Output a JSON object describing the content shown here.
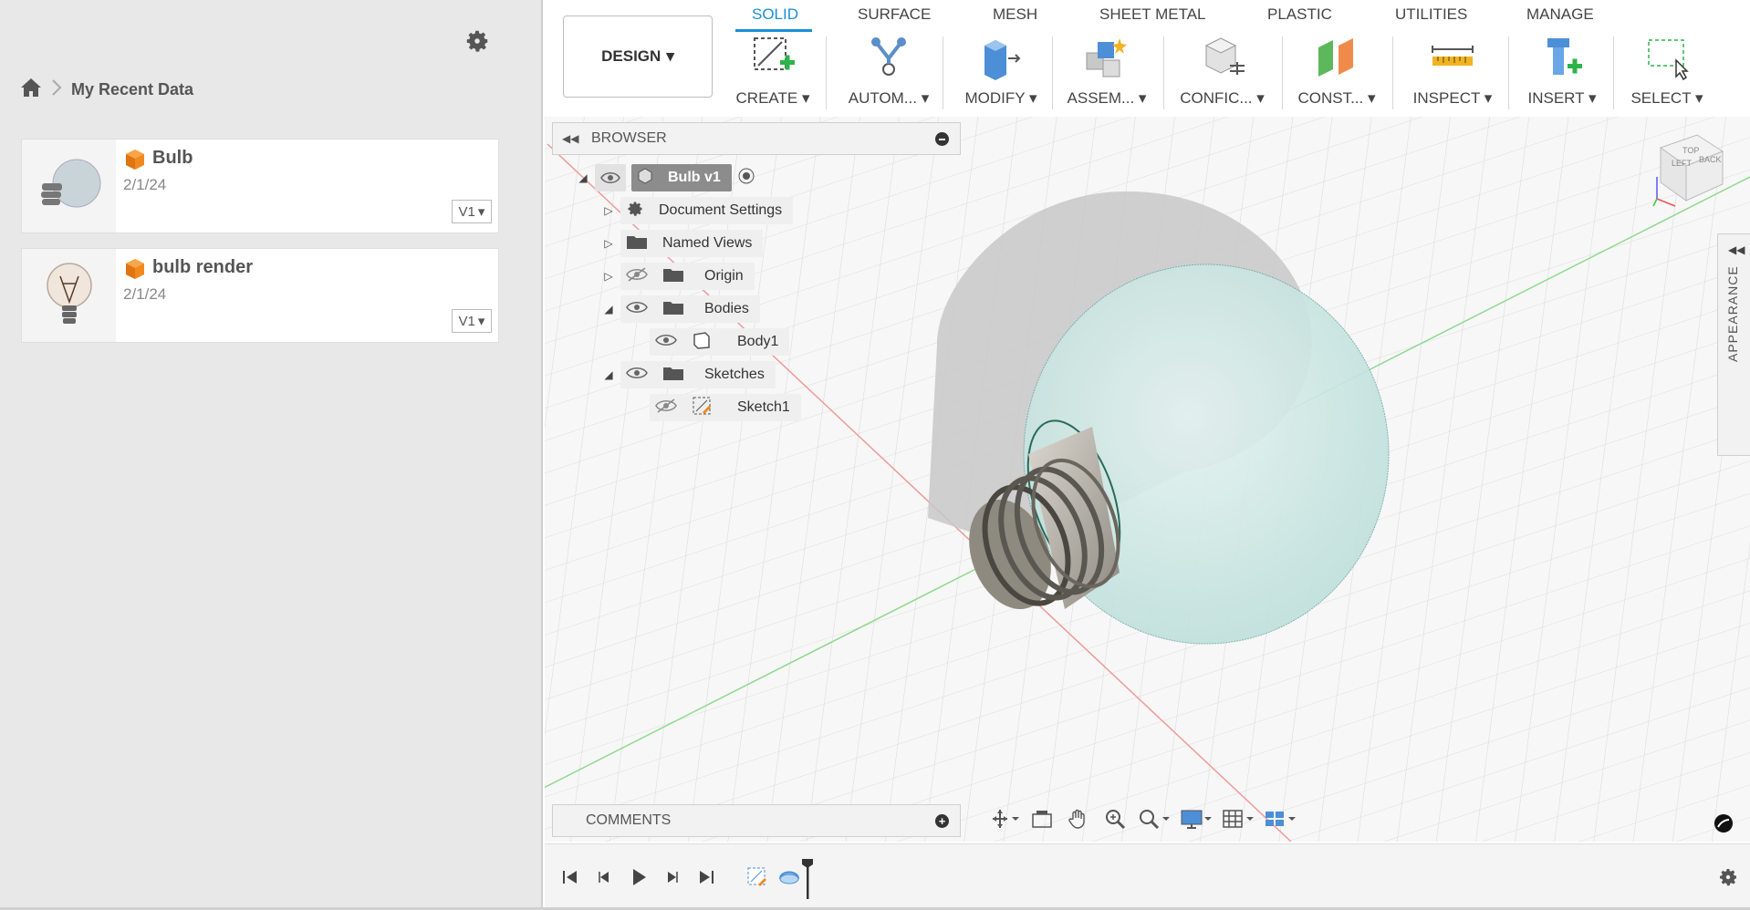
{
  "data_panel": {
    "breadcrumb": {
      "home_icon": "home-icon",
      "separator_icon": "chevron-right-icon",
      "label": "My Recent Data"
    },
    "settings_icon": "gear-icon",
    "files": [
      {
        "name": "Bulb",
        "date": "2/1/24",
        "version": "V1"
      },
      {
        "name": "bulb render",
        "date": "2/1/24",
        "version": "V1"
      }
    ]
  },
  "toolbar": {
    "workspace": "DESIGN",
    "tabs": [
      "SOLID",
      "SURFACE",
      "MESH",
      "SHEET METAL",
      "PLASTIC",
      "UTILITIES",
      "MANAGE"
    ],
    "active_tab": "SOLID",
    "groups": [
      "CREATE",
      "AUTOM...",
      "MODIFY",
      "ASSEM...",
      "CONFIC...",
      "CONST...",
      "INSPECT",
      "INSERT",
      "SELECT"
    ],
    "accent_color": "#1a8fd6"
  },
  "browser": {
    "title": "BROWSER",
    "root": "Bulb v1",
    "items": [
      {
        "label": "Document Settings",
        "icon": "gear-icon"
      },
      {
        "label": "Named Views",
        "icon": "folder-icon"
      },
      {
        "label": "Origin",
        "icon": "folder-icon"
      },
      {
        "label": "Bodies",
        "icon": "folder-icon"
      },
      {
        "label": "Body1",
        "icon": "body-icon"
      },
      {
        "label": "Sketches",
        "icon": "folder-icon"
      },
      {
        "label": "Sketch1",
        "icon": "sketch-icon"
      }
    ]
  },
  "comments": {
    "title": "COMMENTS"
  },
  "appearance": {
    "title": "APPEARANCE"
  },
  "viewcube": {
    "faces": [
      "LEFT",
      "BACK",
      "TOP"
    ],
    "axes": [
      "X",
      "Y",
      "Z"
    ]
  }
}
